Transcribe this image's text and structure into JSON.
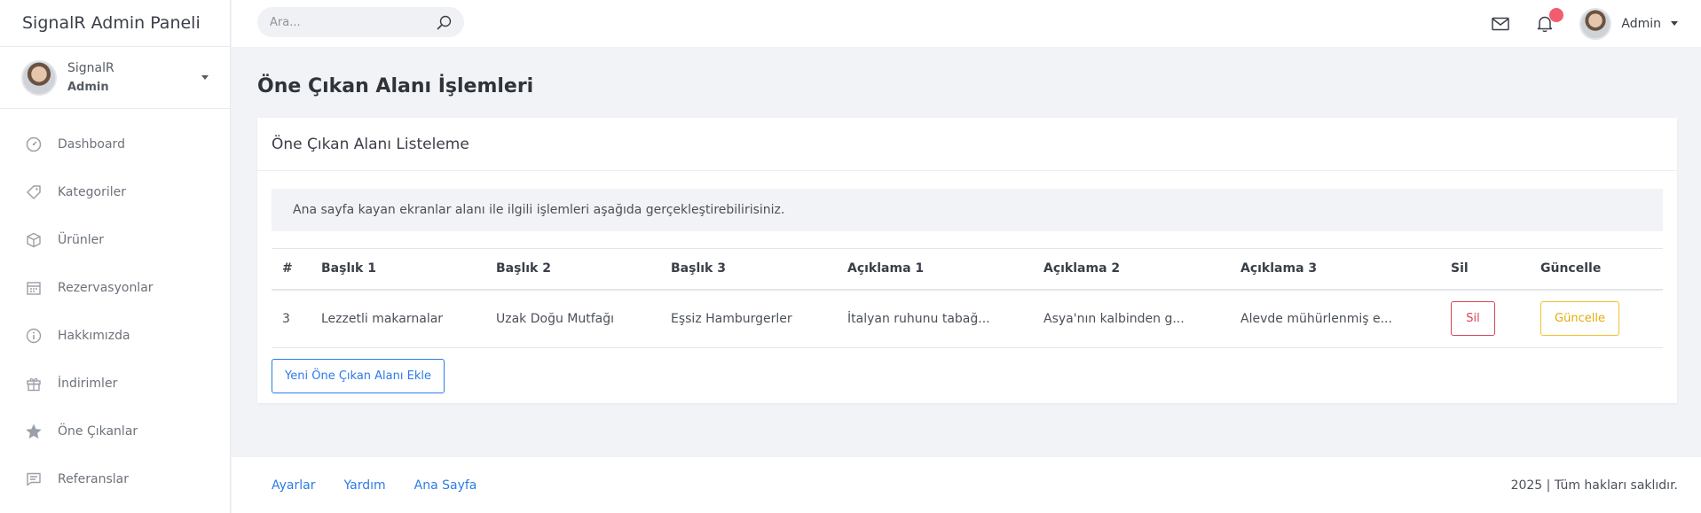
{
  "app": {
    "brand": "SignalR Admin Paneli"
  },
  "profile": {
    "name": "SignalR",
    "role": "Admin"
  },
  "sidebar": {
    "items": [
      {
        "label": "Dashboard",
        "icon": "dashboard-icon"
      },
      {
        "label": "Kategoriler",
        "icon": "tag-icon"
      },
      {
        "label": "Ürünler",
        "icon": "box-icon"
      },
      {
        "label": "Rezervasyonlar",
        "icon": "calendar-icon"
      },
      {
        "label": "Hakkımızda",
        "icon": "info-icon"
      },
      {
        "label": "İndirimler",
        "icon": "gift-icon"
      },
      {
        "label": "Öne Çıkanlar",
        "icon": "star-icon"
      },
      {
        "label": "Referanslar",
        "icon": "message-icon"
      }
    ]
  },
  "topbar": {
    "search_placeholder": "Ara...",
    "user": "Admin"
  },
  "page": {
    "title": "Öne Çıkan Alanı İşlemleri",
    "card_title": "Öne Çıkan Alanı Listeleme",
    "info": "Ana sayfa kayan ekranlar alanı ile ilgili işlemleri aşağıda gerçekleştirebilirisiniz."
  },
  "table": {
    "headers": [
      "#",
      "Başlık 1",
      "Başlık 2",
      "Başlık 3",
      "Açıklama 1",
      "Açıklama 2",
      "Açıklama 3",
      "Sil",
      "Güncelle"
    ],
    "rows": [
      {
        "id": "3",
        "baslik1": "Lezzetli makarnalar",
        "baslik2": "Uzak Doğu Mutfağı",
        "baslik3": "Eşsiz Hamburgerler",
        "aciklama1": "İtalyan ruhunu tabağ...",
        "aciklama2": "Asya'nın kalbinden g...",
        "aciklama3": "Alevde mühürlenmiş e...",
        "sil": "Sil",
        "guncelle": "Güncelle"
      }
    ]
  },
  "actions": {
    "add_label": "Yeni Öne Çıkan Alanı Ekle"
  },
  "footer": {
    "links": [
      "Ayarlar",
      "Yardım",
      "Ana Sayfa"
    ],
    "copyright": "2025 | Tüm hakları saklıdır."
  },
  "colors": {
    "primary": "#2c7be5",
    "danger": "#d64553",
    "warning": "#f2c12b",
    "notification": "#f35b6f"
  }
}
